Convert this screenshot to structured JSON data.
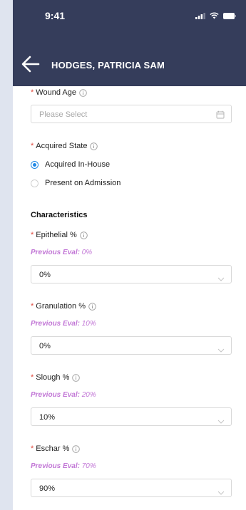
{
  "status_bar": {
    "time": "9:41"
  },
  "header": {
    "title": "HODGES, PATRICIA SAM"
  },
  "wound_age": {
    "label": "Wound Age",
    "placeholder": "Please Select"
  },
  "acquired_state": {
    "label": "Acquired State",
    "options": [
      {
        "label": "Acquired In-House",
        "selected": true
      },
      {
        "label": "Present on Admission",
        "selected": false
      }
    ]
  },
  "characteristics": {
    "title": "Characteristics",
    "prev_prefix": "Previous Eval:",
    "fields": [
      {
        "label": "Epithelial %",
        "previous": "0%",
        "value": "0%"
      },
      {
        "label": "Granulation %",
        "previous": "10%",
        "value": "0%"
      },
      {
        "label": "Slough %",
        "previous": "20%",
        "value": "10%"
      },
      {
        "label": "Eschar %",
        "previous": "70%",
        "value": "90%"
      }
    ]
  },
  "required_marker": "*",
  "colors": {
    "header_bg": "#353d5b",
    "required": "#e0483e",
    "previous_eval": "#c277d6",
    "radio_selected": "#1e88e5"
  }
}
